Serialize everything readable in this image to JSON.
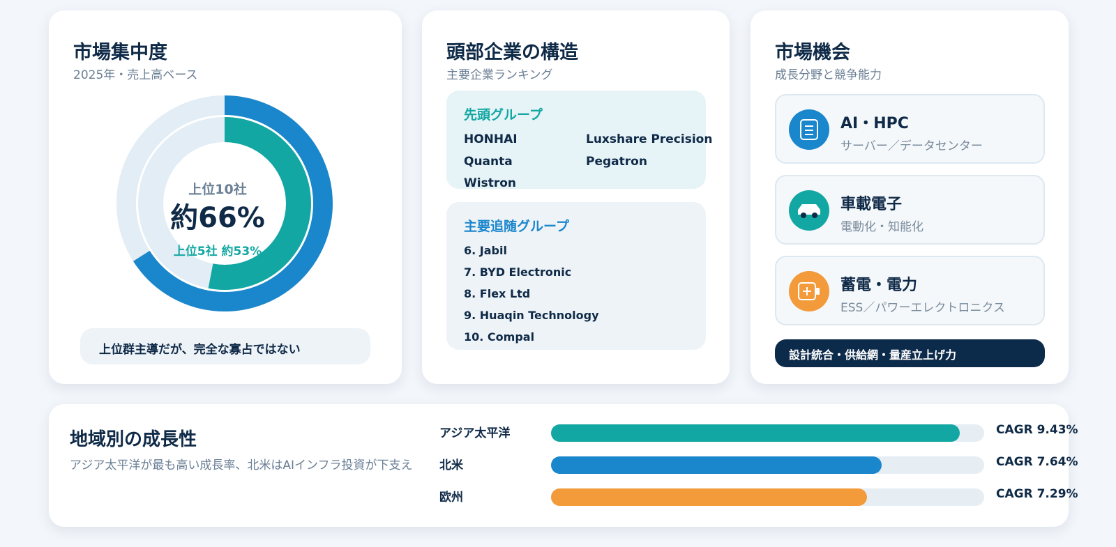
{
  "concentration": {
    "title": "市場集中度",
    "subtitle": "2025年・売上高ベース",
    "center_label": "上位10社",
    "center_value": "約66%",
    "center_sub": "上位5社 約53%",
    "note": "上位群主導だが、完全な寡占ではない",
    "colors": {
      "outer": "#1a86cc",
      "inner": "#12a7a2",
      "track": "#e2edf5"
    }
  },
  "leaders": {
    "title": "頭部企業の構造",
    "subtitle": "主要企業ランキング",
    "lead_group": {
      "title": "先頭グループ",
      "companies": [
        "HONHAI",
        "Luxshare Precision",
        "Quanta",
        "Pegatron",
        "Wistron"
      ]
    },
    "follow_group": {
      "title": "主要追随グループ",
      "companies": [
        "6.  Jabil",
        "7.  BYD Electronic",
        "8.  Flex Ltd",
        "9.  Huaqin Technology",
        "10.  Compal"
      ]
    }
  },
  "opportunities": {
    "title": "市場機会",
    "subtitle": "成長分野と競争能力",
    "items": [
      {
        "title": "AI・HPC",
        "sub": "サーバー／データセンター",
        "icon": "document-icon",
        "color": "#1a86cc"
      },
      {
        "title": "車載電子",
        "sub": "電動化・知能化",
        "icon": "car-icon",
        "color": "#12a7a2"
      },
      {
        "title": "蓄電・電力",
        "sub": "ESS／パワーエレクトロニクス",
        "icon": "battery-icon",
        "color": "#f39a3a"
      }
    ],
    "capability": "設計統合・供給網・量産立上げ力"
  },
  "regional": {
    "title": "地域別の成長性",
    "subtitle": "アジア太平洋が最も高い成長率、北米はAIインフラ投資が下支え",
    "bars": [
      {
        "label": "アジア太平洋",
        "value_text": "CAGR 9.43%",
        "color": "#12a7a2"
      },
      {
        "label": "北米",
        "value_text": "CAGR 7.64%",
        "color": "#1a86cc"
      },
      {
        "label": "欧州",
        "value_text": "CAGR 7.29%",
        "color": "#f39a3a"
      }
    ]
  },
  "chart_data": [
    {
      "type": "pie",
      "title": "市場集中度",
      "subtitle": "2025年・売上高ベース",
      "series": [
        {
          "name": "上位10社",
          "values": [
            66
          ]
        },
        {
          "name": "上位5社",
          "values": [
            53
          ]
        }
      ],
      "unit": "%"
    },
    {
      "type": "bar",
      "title": "地域別の成長性",
      "categories": [
        "アジア太平洋",
        "北米",
        "欧州"
      ],
      "values": [
        9.43,
        7.64,
        7.29
      ],
      "ylabel": "CAGR",
      "unit": "%",
      "ylim": [
        0,
        10
      ]
    }
  ]
}
